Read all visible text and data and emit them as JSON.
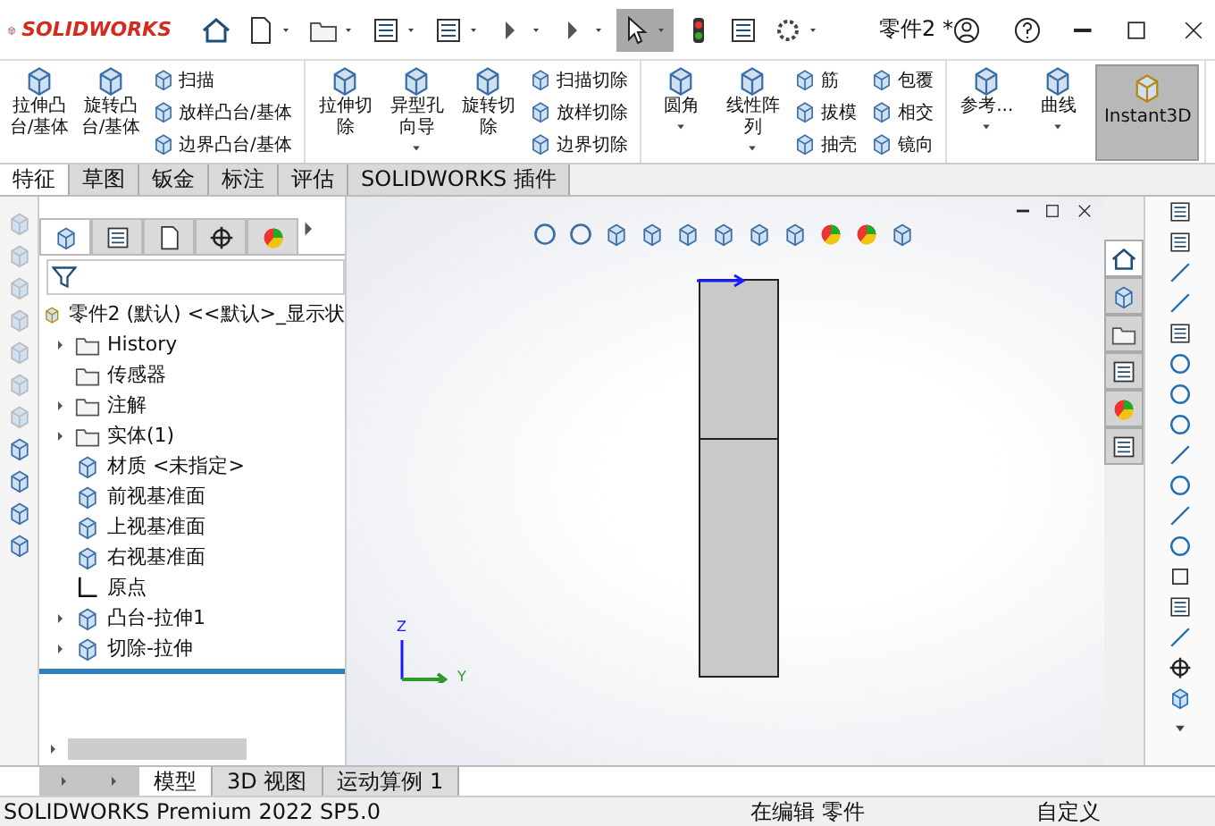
{
  "title_bar": {
    "logo": "SOLIDWORKS",
    "document_title": "零件2 *"
  },
  "ribbon": {
    "groups": [
      {
        "items": [
          {
            "kind": "large",
            "label": "拉伸凸台/基体",
            "caret": false
          },
          {
            "kind": "large",
            "label": "旋转凸台/基体",
            "caret": false
          },
          {
            "kind": "column",
            "entries": [
              "扫描",
              "放样凸台/基体",
              "边界凸台/基体"
            ]
          }
        ]
      },
      {
        "items": [
          {
            "kind": "large",
            "label": "拉伸切除",
            "caret": false
          },
          {
            "kind": "large",
            "label": "异型孔向导",
            "caret": true
          },
          {
            "kind": "large",
            "label": "旋转切除",
            "caret": false
          },
          {
            "kind": "column",
            "entries": [
              "扫描切除",
              "放样切除",
              "边界切除"
            ]
          }
        ]
      },
      {
        "items": [
          {
            "kind": "large",
            "label": "圆角",
            "caret": true
          },
          {
            "kind": "large",
            "label": "线性阵列",
            "caret": true
          },
          {
            "kind": "column",
            "entries": [
              "筋",
              "拔模",
              "抽壳"
            ]
          },
          {
            "kind": "column",
            "entries": [
              "包覆",
              "相交",
              "镜向"
            ]
          }
        ]
      },
      {
        "items": [
          {
            "kind": "large",
            "label": "参考...",
            "caret": true
          },
          {
            "kind": "large",
            "label": "曲线",
            "caret": true
          },
          {
            "kind": "toggle",
            "label": "Instant3D",
            "selected": true
          }
        ]
      }
    ]
  },
  "command_tabs": [
    {
      "label": "特征",
      "selected": true
    },
    {
      "label": "草图",
      "selected": false
    },
    {
      "label": "钣金",
      "selected": false
    },
    {
      "label": "标注",
      "selected": false
    },
    {
      "label": "评估",
      "selected": false
    },
    {
      "label": "SOLIDWORKS 插件",
      "selected": false
    }
  ],
  "feature_manager": {
    "tabs": [
      {
        "selected": true
      },
      {
        "selected": false
      },
      {
        "selected": false
      },
      {
        "selected": false
      },
      {
        "selected": false
      }
    ],
    "tree": {
      "label": "零件2 (默认) <<默认>_显示状",
      "children": [
        {
          "label": "History",
          "expander": true
        },
        {
          "label": "传感器",
          "expander": false
        },
        {
          "label": "注解",
          "expander": true
        },
        {
          "label": "实体(1)",
          "expander": true
        },
        {
          "label": "材质 <未指定>",
          "expander": false
        },
        {
          "label": "前视基准面",
          "expander": false
        },
        {
          "label": "上视基准面",
          "expander": false
        },
        {
          "label": "右视基准面",
          "expander": false
        },
        {
          "label": "原点",
          "expander": false
        },
        {
          "label": "凸台-拉伸1",
          "expander": true
        },
        {
          "label": "切除-拉伸",
          "expander": true
        }
      ]
    }
  },
  "viewport": {
    "triad": {
      "z": "Z",
      "y": "Y"
    }
  },
  "task_pane_tabs": [
    {
      "selected": true
    },
    {
      "selected": false
    },
    {
      "selected": false
    },
    {
      "selected": false
    },
    {
      "selected": false
    },
    {
      "selected": false
    }
  ],
  "bottom_tabs": [
    {
      "label": "模型",
      "selected": true
    },
    {
      "label": "3D 视图",
      "selected": false
    },
    {
      "label": "运动算例 1",
      "selected": false
    }
  ],
  "status_bar": {
    "product": "SOLIDWORKS Premium 2022 SP5.0",
    "mode": "在编辑 零件",
    "units": "自定义"
  }
}
